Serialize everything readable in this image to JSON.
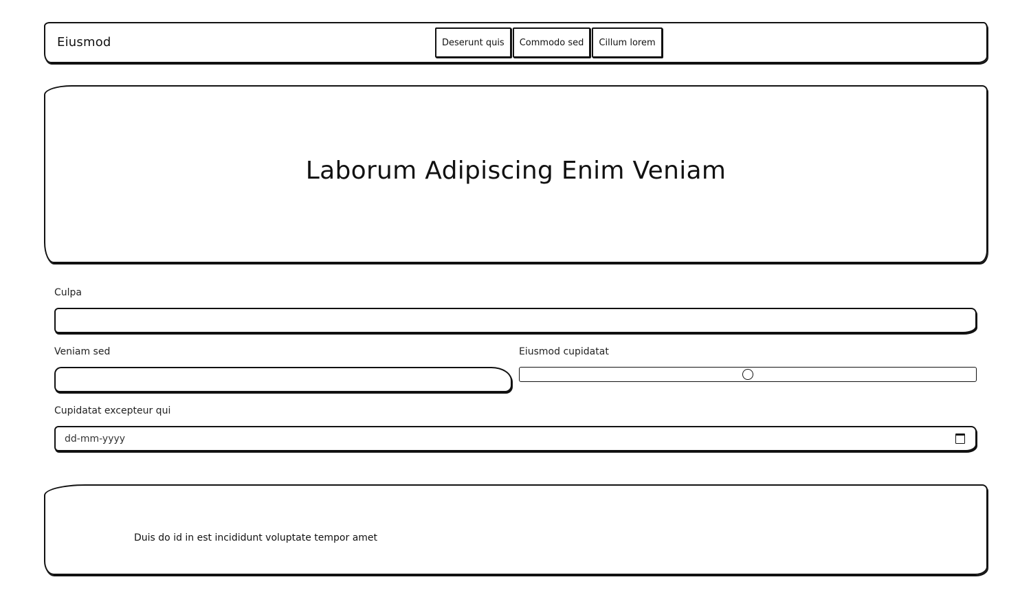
{
  "header": {
    "brand": "Eiusmod",
    "nav": [
      {
        "label": "Deserunt quis"
      },
      {
        "label": "Commodo sed"
      },
      {
        "label": "Cillum lorem"
      }
    ]
  },
  "hero": {
    "title": "Laborum Adipiscing Enim Veniam"
  },
  "form": {
    "culpa": {
      "label": "Culpa",
      "value": ""
    },
    "veniam_sed": {
      "label": "Veniam sed",
      "value": ""
    },
    "eiusmod_cupidatat": {
      "label": "Eiusmod cupidatat",
      "value": 0.5
    },
    "cupidatat_excepteur_qui": {
      "label": "Cupidatat excepteur qui",
      "placeholder": "dd-mm-yyyy"
    }
  },
  "footer": {
    "text": "Duis do id in est incididunt voluptate tempor amet"
  }
}
